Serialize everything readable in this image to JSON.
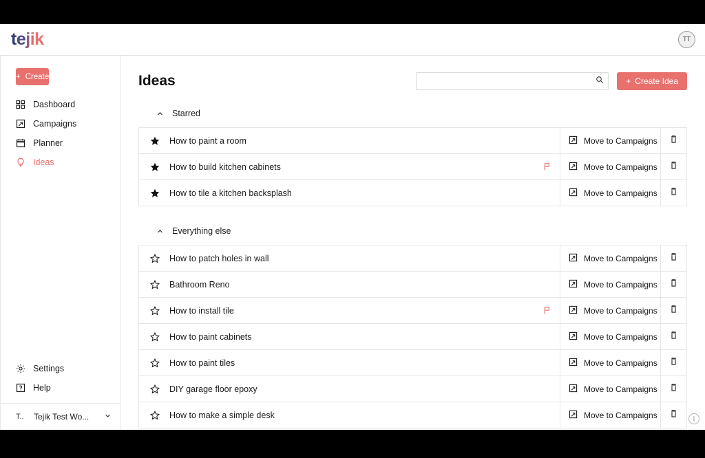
{
  "brand": {
    "logo_text": "tejik",
    "logo_letters": [
      "t",
      "e",
      "j",
      "i",
      "k"
    ],
    "accent_color": "#e8716e",
    "logo_start_color": "#2e3a6e"
  },
  "topbar": {
    "avatar_initials": "TT"
  },
  "sidebar": {
    "create_label": "Create",
    "items": [
      {
        "label": "Dashboard",
        "icon": "dashboard-icon",
        "active": false
      },
      {
        "label": "Campaigns",
        "icon": "campaigns-icon",
        "active": false
      },
      {
        "label": "Planner",
        "icon": "calendar-icon",
        "active": false
      },
      {
        "label": "Ideas",
        "icon": "lightbulb-icon",
        "active": true
      }
    ],
    "footer_items": [
      {
        "label": "Settings",
        "icon": "gear-icon"
      },
      {
        "label": "Help",
        "icon": "help-icon"
      }
    ],
    "workspace": {
      "avatar_text": "T..",
      "name": "Tejik Test Wo...",
      "chevron": "chevron-down-icon"
    }
  },
  "main": {
    "title": "Ideas",
    "search": {
      "value": "",
      "placeholder": "",
      "icon": "search-icon"
    },
    "create_idea_label": "Create Idea",
    "move_label": "Move to Campaigns",
    "sections": [
      {
        "label": "Starred",
        "collapsed": false,
        "rows": [
          {
            "title": "How to paint a room",
            "starred": true,
            "flagged": false
          },
          {
            "title": "How to build kitchen cabinets",
            "starred": true,
            "flagged": true
          },
          {
            "title": "How to tile a kitchen backsplash",
            "starred": true,
            "flagged": false
          }
        ]
      },
      {
        "label": "Everything else",
        "collapsed": false,
        "rows": [
          {
            "title": "How to patch holes in wall",
            "starred": false,
            "flagged": false
          },
          {
            "title": "Bathroom Reno",
            "starred": false,
            "flagged": false
          },
          {
            "title": "How to install tile",
            "starred": false,
            "flagged": true
          },
          {
            "title": "How to paint cabinets",
            "starred": false,
            "flagged": false
          },
          {
            "title": "How to paint tiles",
            "starred": false,
            "flagged": false
          },
          {
            "title": "DIY garage floor epoxy",
            "starred": false,
            "flagged": false
          },
          {
            "title": "How to make a simple desk",
            "starred": false,
            "flagged": false
          }
        ]
      }
    ],
    "info_badge": "i"
  }
}
